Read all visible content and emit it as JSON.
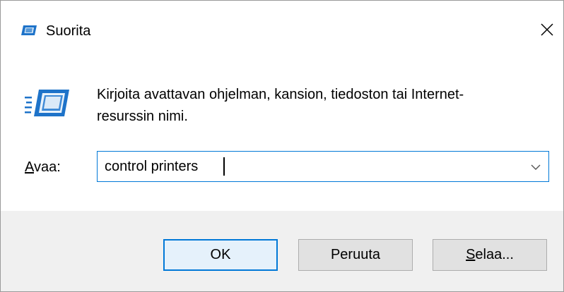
{
  "window": {
    "title": "Suorita",
    "title_icon": "run-icon",
    "close_icon": "close-icon"
  },
  "content": {
    "instruction": "Kirjoita avattavan ohjelman, kansion, tiedoston tai Internet-resurssin nimi.",
    "big_icon": "run-icon",
    "open_label_mnemonic": "A",
    "open_label_rest": "vaa:",
    "open_value": "control printers",
    "dropdown_icon": "chevron-down-icon"
  },
  "buttons": {
    "ok": "OK",
    "cancel": "Peruuta",
    "browse_mnemonic": "S",
    "browse_rest": "elaa..."
  },
  "colors": {
    "accent": "#0078d7",
    "footer_bg": "#f0f0f0",
    "button_bg": "#e1e1e1",
    "default_button_bg": "#e5f1fb"
  }
}
